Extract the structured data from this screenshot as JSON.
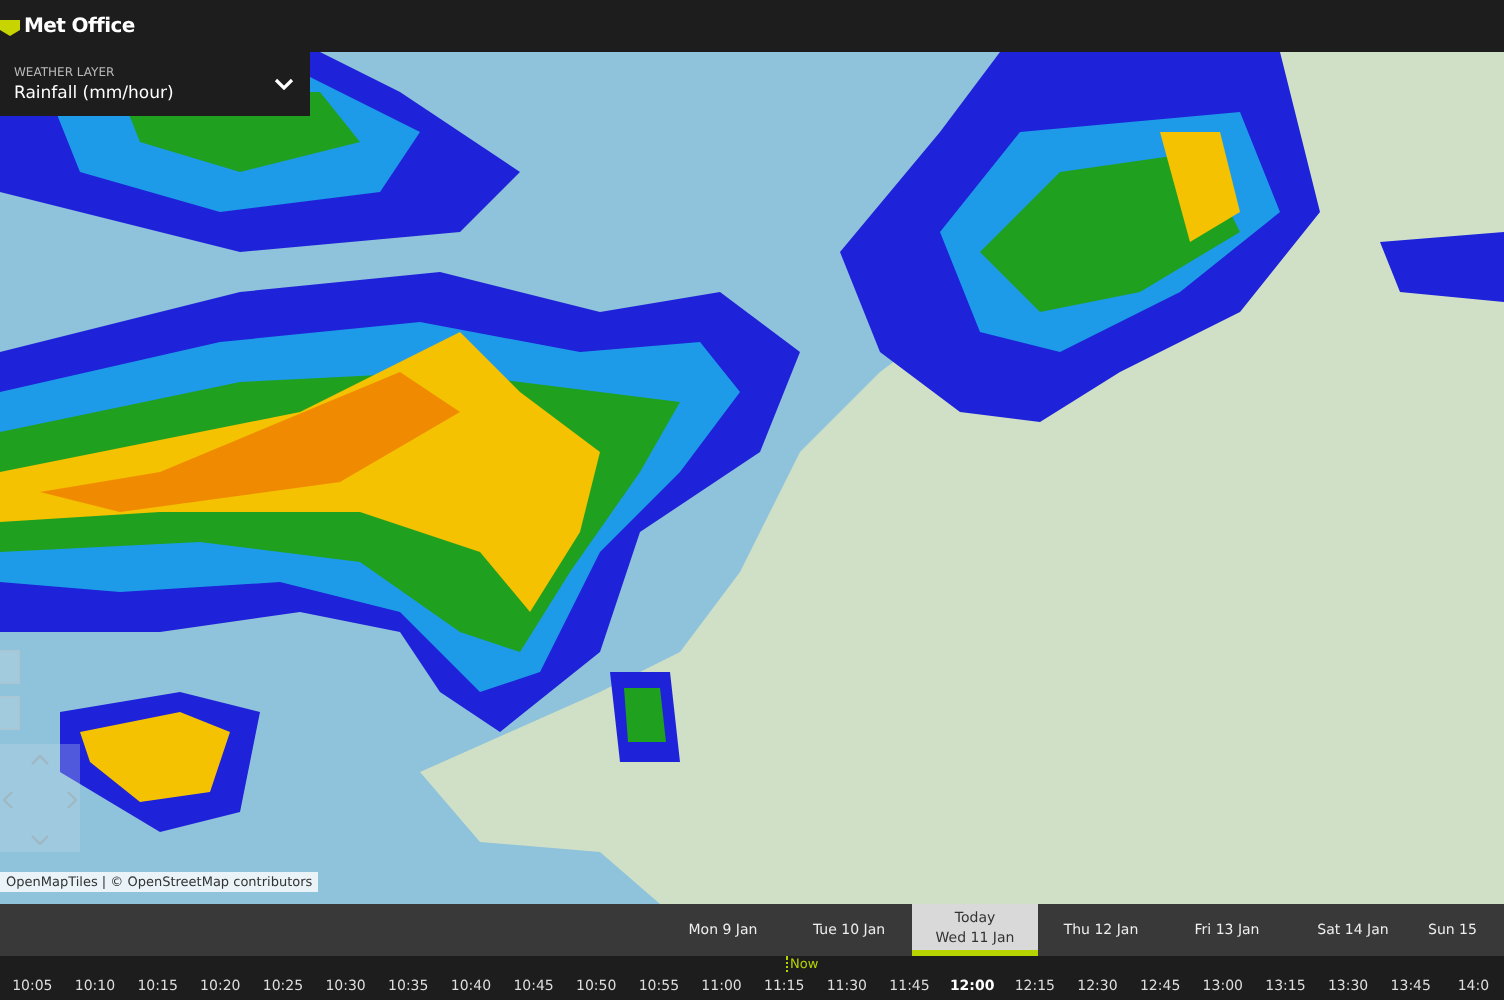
{
  "header": {
    "logo": "Met Office"
  },
  "layer_selector": {
    "label": "WEATHER LAYER",
    "value": "Rainfall (mm/hour)"
  },
  "map": {
    "attribution": "OpenMapTiles | © OpenStreetMap contributors"
  },
  "timeline": {
    "days": [
      {
        "label": "Mon 9 Jan",
        "selected": false
      },
      {
        "label": "Tue 10 Jan",
        "selected": false
      },
      {
        "today": "Today",
        "label": "Wed 11 Jan",
        "selected": true
      },
      {
        "label": "Thu 12 Jan",
        "selected": false
      },
      {
        "label": "Fri 13 Jan",
        "selected": false
      },
      {
        "label": "Sat 14 Jan",
        "selected": false
      },
      {
        "label": "Sun 15",
        "selected": false
      }
    ],
    "now_label": "Now",
    "times": [
      {
        "label": "10:05",
        "selected": false
      },
      {
        "label": "10:10",
        "selected": false
      },
      {
        "label": "10:15",
        "selected": false
      },
      {
        "label": "10:20",
        "selected": false
      },
      {
        "label": "10:25",
        "selected": false
      },
      {
        "label": "10:30",
        "selected": false
      },
      {
        "label": "10:35",
        "selected": false
      },
      {
        "label": "10:40",
        "selected": false
      },
      {
        "label": "10:45",
        "selected": false
      },
      {
        "label": "10:50",
        "selected": false
      },
      {
        "label": "10:55",
        "selected": false
      },
      {
        "label": "11:00",
        "selected": false
      },
      {
        "label": "11:15",
        "selected": false
      },
      {
        "label": "11:30",
        "selected": false
      },
      {
        "label": "11:45",
        "selected": false
      },
      {
        "label": "12:00",
        "selected": true
      },
      {
        "label": "12:15",
        "selected": false
      },
      {
        "label": "12:30",
        "selected": false
      },
      {
        "label": "12:45",
        "selected": false
      },
      {
        "label": "13:00",
        "selected": false
      },
      {
        "label": "13:15",
        "selected": false
      },
      {
        "label": "13:30",
        "selected": false
      },
      {
        "label": "13:45",
        "selected": false
      },
      {
        "label": "14:0",
        "selected": false
      }
    ]
  }
}
